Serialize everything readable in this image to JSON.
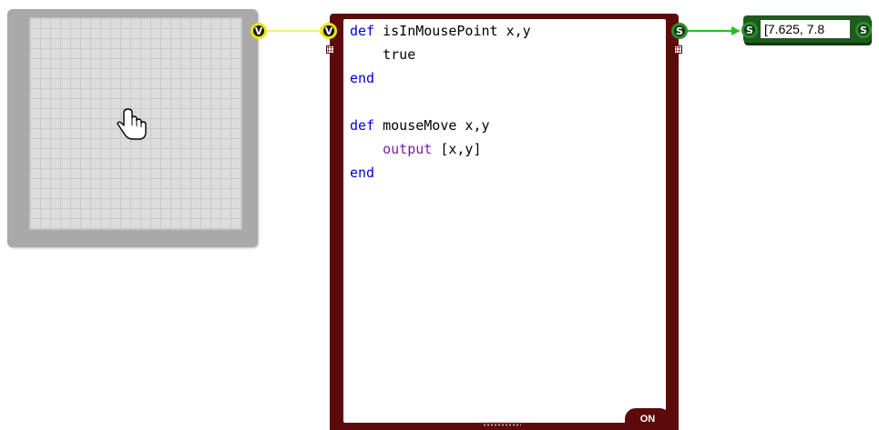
{
  "viewport": {
    "cursor_icon": "hand-pointer-icon"
  },
  "ports": {
    "viewport_out": "V",
    "script_in": "V",
    "script_out": "S",
    "display_in": "S",
    "display_out": "S"
  },
  "script": {
    "lines": [
      [
        {
          "t": "def",
          "c": "kw"
        },
        {
          "t": " isInMousePoint x,y",
          "c": ""
        }
      ],
      [
        {
          "t": "    true",
          "c": ""
        }
      ],
      [
        {
          "t": "end",
          "c": "kw"
        }
      ],
      [
        {
          "t": "",
          "c": ""
        }
      ],
      [
        {
          "t": "def",
          "c": "kw"
        },
        {
          "t": " mouseMove x,y",
          "c": ""
        }
      ],
      [
        {
          "t": "    ",
          "c": ""
        },
        {
          "t": "output",
          "c": "fn"
        },
        {
          "t": " [x,y]",
          "c": ""
        }
      ],
      [
        {
          "t": "end",
          "c": "kw"
        }
      ]
    ],
    "status_badge": "ON"
  },
  "display": {
    "value": "[7.625, 7.8"
  },
  "colors": {
    "block_border": "#5d0a0a",
    "wire_v": "#f0f07a",
    "wire_s": "#22c022",
    "keyword": "#0000d8",
    "function": "#7b1fa2"
  }
}
